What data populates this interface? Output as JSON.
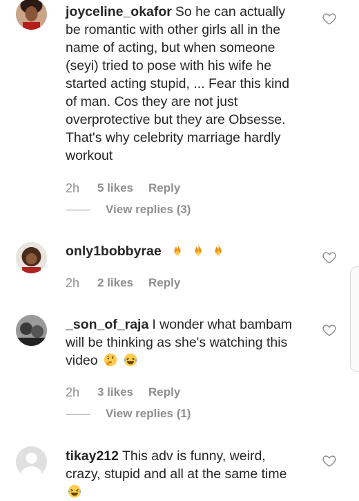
{
  "comments": [
    {
      "username": "joyceline_okafor",
      "text": "So he can actually be romantic with other girls all in the name of acting, but when someone (seyi) tried to pose with his wife he started acting stupid, ... Fear this kind of man. Cos they are not just overprotective but they are Obsesse. That's why celebrity marriage hardly workout",
      "time": "2h",
      "likes": "5 likes",
      "reply": "Reply",
      "view_replies": "View replies (3)"
    },
    {
      "username": "only1bobbyrae",
      "time": "2h",
      "likes": "2 likes",
      "reply": "Reply",
      "emojis": [
        "fire-icon",
        "fire-icon",
        "fire-icon"
      ]
    },
    {
      "username": "_son_of_raja",
      "text": "I wonder what bambam will be thinking as she's watching this video",
      "time": "2h",
      "likes": "3 likes",
      "reply": "Reply",
      "view_replies": "View replies (1)",
      "emojis": [
        "thinking-face-icon",
        "laughing-tears-icon"
      ]
    },
    {
      "username": "tikay212",
      "text": "This adv is funny, weird, crazy, stupid and all at the same time",
      "emojis": [
        "laughing-tears-icon"
      ]
    }
  ],
  "icons": {
    "like": "heart-outline-icon"
  },
  "colors": {
    "text": "#262626",
    "secondary": "#8e8e8e",
    "fire": "#f4900c",
    "emoji_face": "#ffcc4d"
  }
}
